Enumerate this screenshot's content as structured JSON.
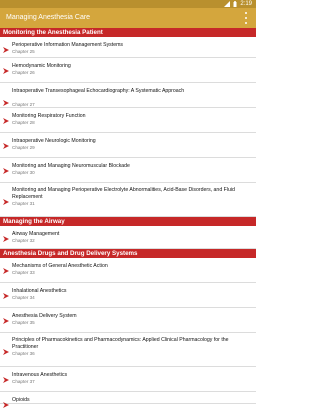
{
  "status_bar": {
    "time": "2:19"
  },
  "app_bar": {
    "title": "Managing Anesthesia Care"
  },
  "sections": [
    {
      "title": "Monitoring the Anesthesia Patient",
      "items": [
        {
          "title": "Perioperative Information Management Systems",
          "chapter": "Chapter 25"
        },
        {
          "title": "Hemodynamic Monitoring",
          "chapter": "Chapter 26"
        },
        {
          "title": "Intraoperative Transesophageal Echocardiography: A Systematic Approach",
          "chapter": "Chapter 27"
        },
        {
          "title": "Monitoring Respiratory Function",
          "chapter": "Chapter 28"
        },
        {
          "title": "Intraoperative Neurologic Monitoring",
          "chapter": "Chapter 29"
        },
        {
          "title": "Monitoring and Managing Neuromuscular Blockade",
          "chapter": "Chapter 30"
        },
        {
          "title": "Monitoring and Managing Perioperative Electrolyte Abnormalities, Acid-Base Disorders, and Fluid Replacement",
          "chapter": "Chapter 31"
        }
      ]
    },
    {
      "title": "Managing the Airway",
      "items": [
        {
          "title": "Airway Management",
          "chapter": "Chapter 32"
        }
      ]
    },
    {
      "title": "Anesthesia Drugs and Drug Delivery Systems",
      "items": [
        {
          "title": "Mechanisms of General Anesthetic Action",
          "chapter": "Chapter 33"
        },
        {
          "title": "Inhalational Anesthetics",
          "chapter": "Chapter 34"
        },
        {
          "title": "Anesthesia Delivery System",
          "chapter": "Chapter 35"
        },
        {
          "title": "Principles of Pharmacokinetics and Pharmacodynamics: Applied Clinical Pharmacology for the Practitioner",
          "chapter": "Chapter 36"
        },
        {
          "title": "Intravenous Anesthetics",
          "chapter": "Chapter 37"
        },
        {
          "title": "Opioids",
          "chapter": ""
        }
      ]
    }
  ],
  "colors": {
    "app_bar": "#d4a63d",
    "status_bar": "#b9902e",
    "section_header": "#c62828",
    "arrow": "#c62828"
  },
  "icons": {
    "item_arrow": "chevron-arrow-icon",
    "menu": "overflow-menu-icon",
    "signal": "signal-icon",
    "battery": "battery-icon"
  }
}
